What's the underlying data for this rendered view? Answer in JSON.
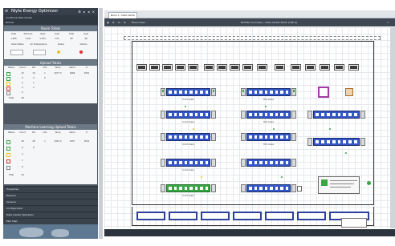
{
  "app": {
    "title": "Nlyte Energy Optimizer"
  },
  "panel": {
    "location_row": "Locations  Data Center",
    "group_row": "Rooms",
    "rack_view": {
      "title": "Room Totals",
      "headers": [
        "Total",
        "Nominal",
        "Used",
        "Avail",
        "Total",
        "Avail"
      ],
      "values": [
        "1,485",
        "1,341",
        "1,354",
        "131",
        "68",
        "48"
      ],
      "status_labels": [
        "Rack Status",
        "Air Temperature",
        "Power",
        "Alarms"
      ]
    },
    "upload_title": "Upload Totals",
    "upload_headers": [
      "Status",
      "Count",
      "kW",
      "kVA",
      "Temp",
      "Alarm",
      "%"
    ],
    "upload_rows": [
      {
        "v": [
          "10",
          "10",
          "1",
          "1",
          "2677.3",
          "2666",
          "2001"
        ]
      },
      {
        "v": [
          "5",
          "5",
          "0",
          "0",
          "0",
          "0",
          "0"
        ]
      },
      {
        "v": [
          "1",
          "1",
          "0",
          "0",
          "0",
          "0",
          "0"
        ]
      },
      {
        "v": [
          "2",
          "2",
          "0",
          "0",
          "0",
          "0",
          "0"
        ]
      },
      {
        "v": [
          "0",
          "0",
          "0",
          "0",
          "0",
          "0",
          "0"
        ]
      }
    ],
    "upload_total": [
      "Total",
      "18"
    ],
    "ml_title": "Machine Learning Upload Totals",
    "ml_rows": [
      {
        "v": [
          "28",
          "28",
          "1",
          "1",
          "2427.4",
          "2457",
          "3041"
        ]
      },
      {
        "v": [
          "8",
          "8",
          "0",
          "0",
          "0",
          "0",
          "0"
        ]
      },
      {
        "v": [
          "2",
          "2",
          "0",
          "0",
          "0",
          "0",
          "0"
        ]
      },
      {
        "v": [
          "1",
          "1",
          "0",
          "0",
          "0",
          "0",
          "0"
        ]
      },
      {
        "v": [
          "0",
          "0",
          "0",
          "0",
          "0",
          "0",
          "0"
        ]
      }
    ],
    "ml_total": [
      "Total",
      "39"
    ],
    "accordion": [
      "Properties",
      "Reports",
      "Sensors",
      "Configuration",
      "Data Center Operation",
      "Mini Map"
    ]
  },
  "tabs": {
    "active": "Room 1 - Data Center Hall"
  },
  "toolbar": {
    "label": "Room View",
    "center": "Portfolio Summary - Data Center Room (Hall A)"
  },
  "canvas": {
    "aisle_labels": [
      "Cold Aisle",
      "Hot Aisle",
      "Cold Aisle",
      "Hot Aisle",
      "Cold Aisle",
      "Hot Aisle",
      "Cold Aisle",
      "Cold Aisle"
    ]
  },
  "colors": {
    "rack_blue": "#3457c7",
    "rack_green": "#3aa545",
    "alarm_yellow": "#f0c21a"
  },
  "icons": [
    "menu-icon",
    "save-icon",
    "zoom-in-icon",
    "zoom-out-icon",
    "settings-icon",
    "close-icon"
  ]
}
